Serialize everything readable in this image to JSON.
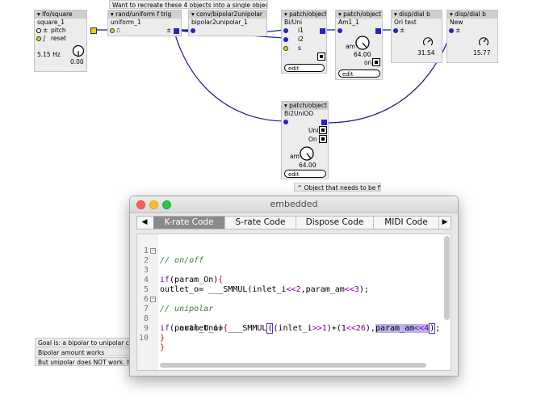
{
  "objects": {
    "square": {
      "header": "lfo/square",
      "name": "square_1",
      "param_pitch": "pitch",
      "param_reset": "reset",
      "freq": "5.15 Hz",
      "knob_value": "0.00"
    },
    "uniform": {
      "header": "rand/uniform f trig",
      "name": "uniform_1",
      "out_symbol": "±"
    },
    "conv": {
      "header": "conv/bipolar2unipolar",
      "name": "bipolar2unipolar_1"
    },
    "biuni": {
      "header": "patch/object",
      "name": "Bi/Uni",
      "in1": "i1",
      "in2": "i2",
      "in3": "s",
      "edit": "edit"
    },
    "am1": {
      "header": "patch/object",
      "name": "Am1_1",
      "knob_label": "am",
      "knob_value": "64.00",
      "toggle_label": "on",
      "edit": "edit"
    },
    "dial1": {
      "header": "disp/dial b",
      "name": "Ori test",
      "value": "31.54",
      "in_symbol": "±"
    },
    "dial2": {
      "header": "disp/dial b",
      "name": "New",
      "value": "15.77",
      "in_symbol": "±"
    },
    "bi2uni": {
      "header": "patch/object",
      "name": "Bi2UniOO",
      "toggle1_label": "Uni",
      "toggle2_label": "On",
      "knob_label": "am",
      "knob_value": "64.00",
      "edit": "edit"
    }
  },
  "comments": {
    "top": "Want to recreate these 4 objects into a single object",
    "fix": "^ Object that needs to be fixed",
    "goal": "Goal is: a bipolar to unipolar c",
    "bipolar": "Bipolar amount works",
    "unipolar": "But unipolar does NOT work. It"
  },
  "window": {
    "title": "embedded",
    "tabs": [
      "K-rate Code",
      "S-rate Code",
      "Dispose Code",
      "MIDI Code"
    ],
    "active_tab": "K-rate Code",
    "left_arrow": "◀",
    "right_arrow": "▶"
  },
  "code": {
    "line_numbers": [
      "1",
      "2",
      "3",
      "4",
      "5",
      "6",
      "7",
      "8",
      "9",
      "10"
    ],
    "l1": "// on/off",
    "l2_kw": "if",
    "l2_rest": "(param_On)",
    "l2_br": "{",
    "l4_a": "outlet_o= ___SMMUL(inlet_i",
    "l4_b": "<<2",
    "l4_c": ",param_am",
    "l4_d": "<<3",
    "l4_e": ");",
    "l6": "// unipolar",
    "l7_kw": "if",
    "l7_rest": "(param_Uni)",
    "l7_br": "{",
    "l8_a": "    outlet_o= ___SMMUL",
    "l8_b": "(",
    "l8_c": "(inlet_i",
    "l8_d": ">>1",
    "l8_e": ")+(1",
    "l8_f": "<<26",
    "l8_g": "),",
    "l8_h": "param_am",
    "l8_i": "<<4",
    "l8_j": ")",
    "l8_k": ";",
    "l9": "}",
    "l10": "}"
  },
  "colors": {
    "wire": "#1e1e9e",
    "port": "#2323c8",
    "selection": "#b9b4ee"
  }
}
